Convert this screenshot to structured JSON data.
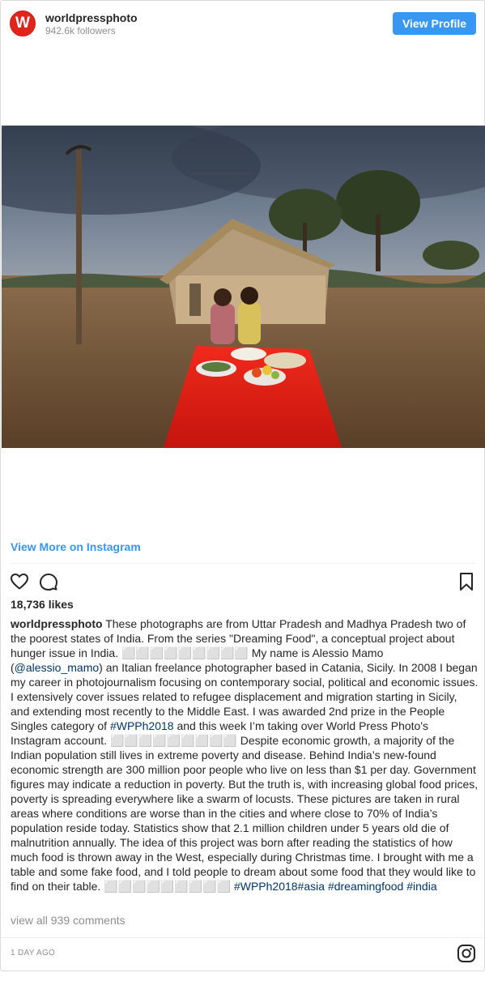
{
  "header": {
    "avatar_letter": "W",
    "username": "worldpressphoto",
    "followers": "942.6k followers",
    "view_profile_label": "View Profile"
  },
  "view_more_label": "View More on Instagram",
  "likes": "18,736 likes",
  "caption": {
    "username": "worldpressphoto",
    "part1": " These photographs are from Uttar Pradesh and Madhya Pradesh two of the poorest states of India. From the series \"Dreaming Food\", a conceptual project about hunger issue in India. ⬜⬜⬜⬜⬜⬜⬜⬜⬜ My name is Alessio Mamo (",
    "mention": "@alessio_mamo",
    "part2": ") an Italian freelance photographer based in Catania, Sicily. In 2008 I began my career in photojournalism focusing on contemporary social, political and economic issues. I extensively cover issues related to refugee displacement and migration starting in Sicily, and extending most recently to the Middle East. I was awarded 2nd prize in the People Singles category of ",
    "hashtag1": "#WPPh2018",
    "part3": " and this week I’m taking over World Press Photo's Instagram account. ⬜⬜⬜⬜⬜⬜⬜⬜⬜ Despite economic growth, a majority of the Indian population still lives in extreme poverty and disease. Behind India’s new-found economic strength are 300 million poor people who live on less than $1 per day. Government figures may indicate a reduction in poverty. But the truth is, with increasing global food prices, poverty is spreading everywhere like a swarm of locusts. These pictures are taken in rural areas where conditions are worse than in the cities and where close to 70% of India’s population reside today. Statistics show that 2.1 million children under 5 years old die of malnutrition annually. The idea of this project was born after reading the statistics of how much food is thrown away in the West, especially during Christmas time. I brought with me a table and some fake food, and I told people to dream about some food that they would like to find on their table. ⬜⬜⬜⬜⬜⬜⬜⬜⬜ ",
    "hashtag2": "#WPPh2018",
    "hashtag3": "#asia",
    "hashtag4": "#dreamingfood",
    "hashtag5": "#india"
  },
  "comments_label": "view all 939 comments",
  "time_ago": "1 DAY AGO",
  "icons": {
    "like": "heart-icon",
    "comment": "comment-icon",
    "save": "bookmark-icon",
    "brand": "instagram-icon"
  },
  "colors": {
    "accent": "#3897f0",
    "brand_red": "#e1251b",
    "link": "#003569",
    "muted": "#8e8e8e"
  }
}
